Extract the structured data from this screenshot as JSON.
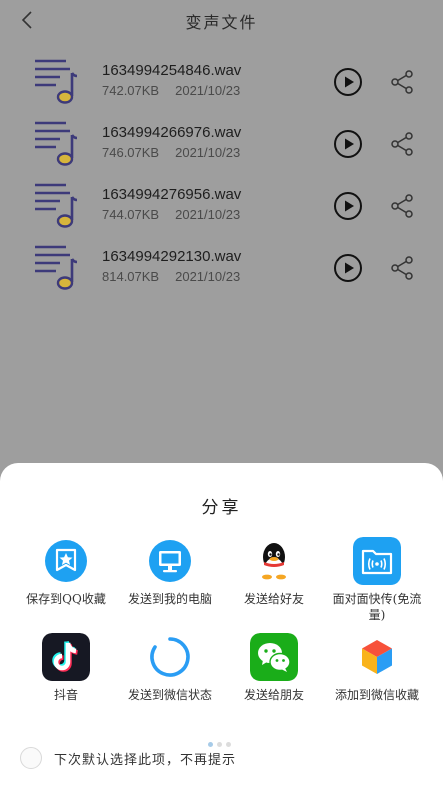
{
  "header": {
    "title": "变声文件"
  },
  "files": [
    {
      "name": "1634994254846.wav",
      "size": "742.07KB",
      "date": "2021/10/23"
    },
    {
      "name": "1634994266976.wav",
      "size": "746.07KB",
      "date": "2021/10/23"
    },
    {
      "name": "1634994276956.wav",
      "size": "744.07KB",
      "date": "2021/10/23"
    },
    {
      "name": "1634994292130.wav",
      "size": "814.07KB",
      "date": "2021/10/23"
    }
  ],
  "share_sheet": {
    "title": "分享",
    "items": [
      {
        "label": "保存到QQ收藏",
        "icon": "qq-favorite-icon"
      },
      {
        "label": "发送到我的电脑",
        "icon": "my-computer-icon"
      },
      {
        "label": "发送给好友",
        "icon": "qq-penguin-icon"
      },
      {
        "label": "面对面快传(免流量)",
        "icon": "face-to-face-transfer-icon"
      },
      {
        "label": "抖音",
        "icon": "douyin-icon"
      },
      {
        "label": "发送到微信状态",
        "icon": "wechat-status-icon"
      },
      {
        "label": "发送给朋友",
        "icon": "wechat-icon"
      },
      {
        "label": "添加到微信收藏",
        "icon": "wechat-favorite-icon"
      }
    ],
    "checkbox_label": "下次默认选择此项，不再提示"
  },
  "colors": {
    "overlay": "#9e9e9e",
    "note_purple": "#3d3a7a",
    "note_gold": "#d6b53c",
    "qq_blue": "#1ea1f2",
    "wechat_green": "#1aad19"
  }
}
